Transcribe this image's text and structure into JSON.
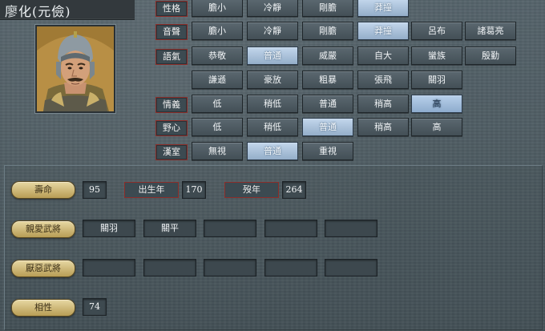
{
  "header": {
    "name": "廖化(元儉)"
  },
  "rows": [
    {
      "label": "性格",
      "options": [
        "膽小",
        "冷靜",
        "剛膽",
        "莽撞"
      ],
      "selected": 3
    },
    {
      "label": "音聲",
      "options": [
        "膽小",
        "冷靜",
        "剛膽",
        "莽撞",
        "呂布",
        "諸葛亮"
      ],
      "selected": 3
    },
    {
      "label": "語氣",
      "options": [
        "恭敬",
        "普通",
        "威嚴",
        "自大",
        "蠻族",
        "殷勤"
      ],
      "selected": 1
    },
    {
      "label": "",
      "options": [
        "謙遜",
        "豪放",
        "粗暴",
        "張飛",
        "關羽"
      ],
      "selected": -1
    },
    {
      "label": "情義",
      "options": [
        "低",
        "稍低",
        "普通",
        "稍高",
        "高"
      ],
      "selected": 4
    },
    {
      "label": "野心",
      "options": [
        "低",
        "稍低",
        "普通",
        "稍高",
        "高"
      ],
      "selected": 2
    },
    {
      "label": "漢室",
      "options": [
        "無視",
        "普通",
        "重視"
      ],
      "selected": 1
    }
  ],
  "stats": {
    "lifespan_label": "壽命",
    "lifespan": "95",
    "birth_label": "出生年",
    "birth": "170",
    "death_label": "歿年",
    "death": "264"
  },
  "liked": {
    "label": "親愛武將",
    "generals": [
      "關羽",
      "關平",
      "",
      "",
      ""
    ]
  },
  "disliked": {
    "label": "厭惡武將",
    "generals": [
      "",
      "",
      "",
      "",
      ""
    ]
  },
  "compat": {
    "label": "相性",
    "value": "74"
  }
}
